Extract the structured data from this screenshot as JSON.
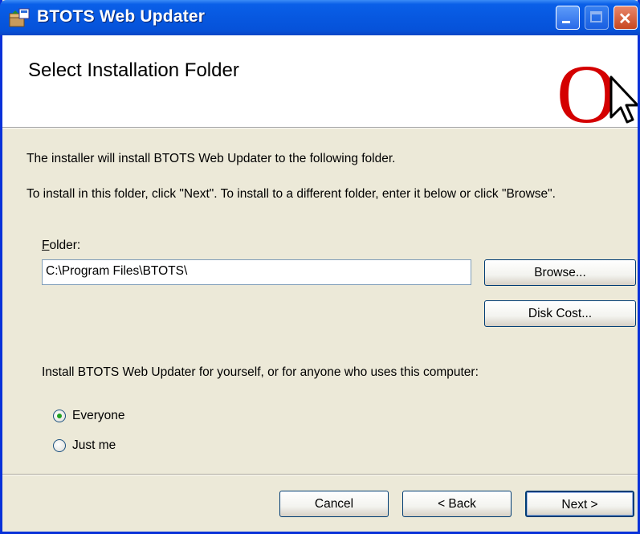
{
  "window": {
    "title": "BTOTS Web Updater",
    "title_icon": "installer-package-icon",
    "controls": {
      "minimize": "minimize-icon",
      "maximize": "maximize-icon",
      "close": "close-icon"
    }
  },
  "banner": {
    "heading": "Select Installation Folder",
    "logo": "O"
  },
  "body": {
    "intro": "The installer will install BTOTS Web Updater to the following folder.",
    "instructions": "To install in this folder, click \"Next\". To install to a different folder, enter it below or click \"Browse\".",
    "folder_label_first": "F",
    "folder_label_rest": "older:",
    "folder_value": "C:\\Program Files\\BTOTS\\",
    "browse_label": "Browse...",
    "disk_cost_label": "Disk Cost...",
    "install_for": "Install BTOTS Web Updater for yourself, or for anyone who uses this computer:",
    "options": [
      {
        "label": "Everyone",
        "selected": true
      },
      {
        "label": "Just me",
        "selected": false
      }
    ]
  },
  "footer": {
    "cancel_label": "Cancel",
    "back_label": "< Back",
    "next_label": "Next >"
  },
  "colors": {
    "titlebar": "#0652d9",
    "face": "#ece9d8",
    "logo_red": "#d40000",
    "radio_dot": "#21a121"
  }
}
